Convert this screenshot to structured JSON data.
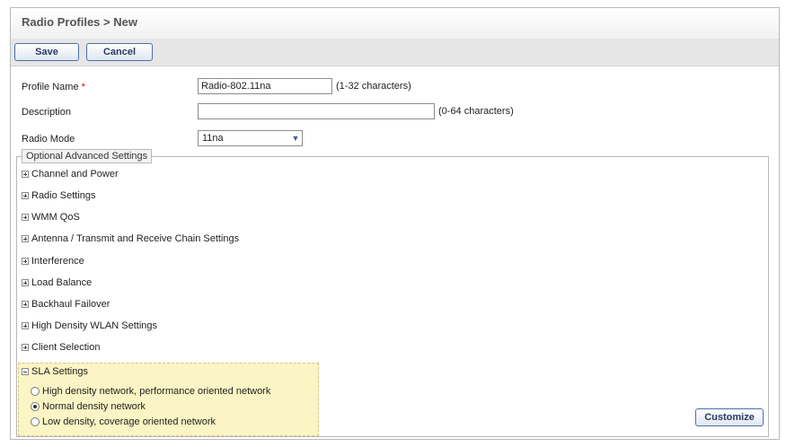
{
  "header": {
    "title": "Radio Profiles > New"
  },
  "toolbar": {
    "save_label": "Save",
    "cancel_label": "Cancel"
  },
  "form": {
    "profile_name": {
      "label": "Profile Name",
      "required_marker": "*",
      "value": "Radio-802.11na",
      "hint": "(1-32 characters)"
    },
    "description": {
      "label": "Description",
      "value": "",
      "hint": "(0-64 characters)"
    },
    "radio_mode": {
      "label": "Radio Mode",
      "selected": "11na"
    }
  },
  "advanced": {
    "legend": "Optional Advanced Settings",
    "sections": [
      {
        "label": "Channel and Power"
      },
      {
        "label": "Radio Settings"
      },
      {
        "label": "WMM QoS"
      },
      {
        "label": "Antenna / Transmit and Receive Chain Settings"
      },
      {
        "label": "Interference"
      },
      {
        "label": "Load Balance"
      },
      {
        "label": "Backhaul Failover"
      },
      {
        "label": "High Density WLAN Settings"
      },
      {
        "label": "Client Selection"
      }
    ],
    "sla": {
      "label": "SLA Settings",
      "options": [
        {
          "label": "High density network, performance oriented network",
          "selected": false
        },
        {
          "label": "Normal density network",
          "selected": true
        },
        {
          "label": "Low density, coverage oriented network",
          "selected": false
        }
      ]
    },
    "customize_label": "Customize"
  }
}
